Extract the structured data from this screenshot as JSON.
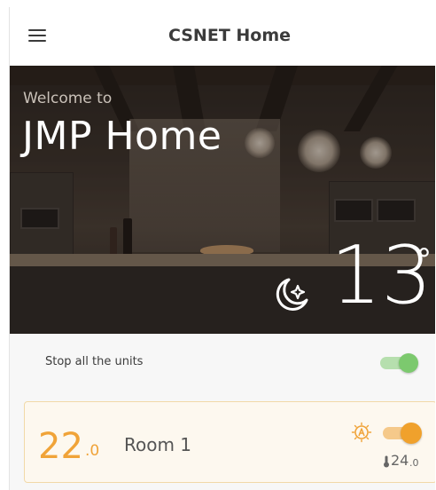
{
  "header": {
    "title": "CSNET Home",
    "menu_icon": "hamburger-menu-icon"
  },
  "hero": {
    "welcome_text": "Welcome to",
    "home_name": "JMP Home",
    "weather_icon": "moon-star-icon",
    "outdoor_temp": "13",
    "temp_unit": "°"
  },
  "stop_all": {
    "label": "Stop all the units",
    "toggle_on": true,
    "toggle_color": "#7cc96e"
  },
  "rooms": [
    {
      "temp_int": "22",
      "temp_dec": ".0",
      "name": "Room 1",
      "mode_icon": "auto-mode-icon",
      "toggle_on": true,
      "setpoint_int": "24",
      "setpoint_dec": ".0",
      "accent_color": "#f0a338"
    }
  ]
}
